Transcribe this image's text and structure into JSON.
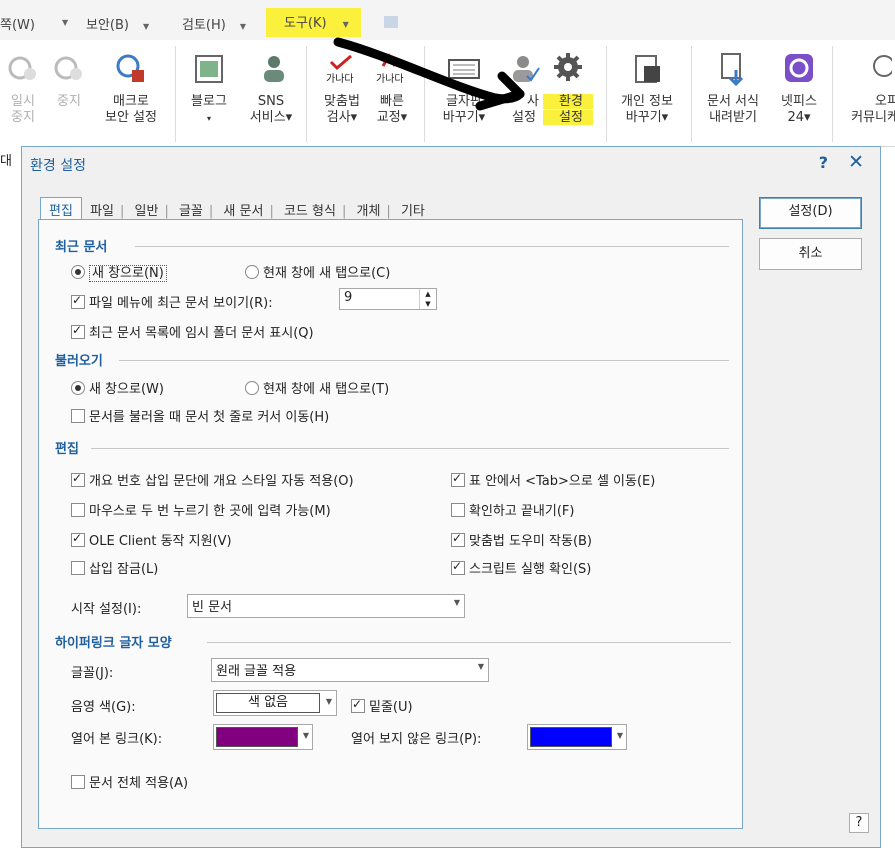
{
  "menubar": {
    "items": [
      "쪽(W)",
      "보안(B)",
      "검토(H)",
      "도구(K)"
    ],
    "highlight_color": "#fbf03b"
  },
  "ribbon": {
    "buttons": [
      {
        "label1": "일시",
        "label2": "중지",
        "disabled": true
      },
      {
        "label1": "중지",
        "label2": "",
        "disabled": true
      },
      {
        "label1": "매크로",
        "label2": "보안 설정"
      },
      {
        "label1": "블로그",
        "label2": "▾"
      },
      {
        "label1": "SNS",
        "label2": "서비스▾"
      },
      {
        "label1": "맞춤법",
        "label2": "검사▾"
      },
      {
        "label1": "빠른",
        "label2": "교정▾"
      },
      {
        "label1": "글자판",
        "label2": "바꾸기▾"
      },
      {
        "label1": "사",
        "label2": "설정"
      },
      {
        "label1": "환경",
        "label2": "설정"
      },
      {
        "label1": "개인 정보",
        "label2": "바꾸기▾"
      },
      {
        "label1": "문서 서식",
        "label2": "내려받기"
      },
      {
        "label1": "넷피스",
        "label2": "24▾"
      },
      {
        "label1": "오피",
        "label2": "커뮤니케"
      }
    ],
    "icon_text": "가나다"
  },
  "doc_fragment": "대",
  "dialog": {
    "title": "환경 설정",
    "help": "?",
    "close": "✕",
    "ok": "설정(D)",
    "cancel": "취소",
    "corner_help": "?",
    "tabs": [
      "편집",
      "파일",
      "일반",
      "글꼴",
      "새 문서",
      "코드 형식",
      "개체",
      "기타"
    ],
    "recent": {
      "heading": "최근 문서",
      "radio_new_window": "새 창으로(N)",
      "radio_new_tab": "현재 창에 새 탭으로(C)",
      "show_recent": "파일 메뉴에 최근 문서 보이기(R):",
      "recent_count": "9",
      "show_temp": "최근 문서 목록에 임시 폴더 문서 표시(Q)"
    },
    "open": {
      "heading": "불러오기",
      "radio_new_window": "새 창으로(W)",
      "radio_new_tab": "현재 창에 새 탭으로(T)",
      "move_cursor": "문서를 불러올 때 문서 첫 줄로 커서 이동(H)"
    },
    "edit": {
      "heading": "편집",
      "outline_style": "개요 번호 삽입 문단에 개요 스타일 자동 적용(O)",
      "dblclick_input": "마우스로 두 번 누르기 한 곳에 입력 가능(M)",
      "ole": "OLE Client 동작 지원(V)",
      "insert_lock": "삽입 잠금(L)",
      "tab_in_table": "표 안에서 <Tab>으로 셀 이동(E)",
      "confirm_exit": "확인하고 끝내기(F)",
      "spell_helper": "맞춤법 도우미 작동(B)",
      "script_confirm": "스크립트 실행 확인(S)",
      "start_label": "시작 설정(I):",
      "start_value": "빈 문서"
    },
    "hyperlink": {
      "heading": "하이퍼링크 글자 모양",
      "font_label": "글꼴(J):",
      "font_value": "원래 글꼴 적용",
      "shade_label": "음영 색(G):",
      "shade_value": "색 없음",
      "underline": "밑줄(U)",
      "visited_label": "열어 본 링크(K):",
      "visited_color": "#800080",
      "unvisited_label": "열어 보지 않은 링크(P):",
      "unvisited_color": "#0000ff",
      "apply_all": "문서 전체 적용(A)"
    }
  }
}
